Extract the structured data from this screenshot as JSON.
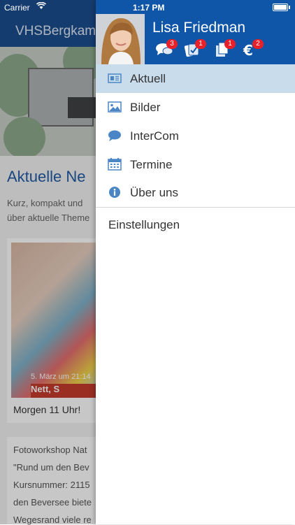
{
  "status_bar": {
    "carrier": "Carrier",
    "time": "1:17 PM"
  },
  "background": {
    "header_title": "VHSBergkam",
    "heading": "Aktuelle Ne",
    "intro_lines": [
      "Kurz, kompakt und",
      "über aktuelle Theme"
    ],
    "photo_date": "5. März um 21:14",
    "photo_sign": "Nett, S",
    "caption": "Morgen 11 Uhr!",
    "para_lines": [
      "Fotoworkshop Nat",
      "\"Rund um den Bev",
      "Kursnummer: 2115",
      "den Beversee biete",
      "Wegesrand viele re"
    ]
  },
  "drawer": {
    "user_name": "Lisa Friedman",
    "header_icons": [
      {
        "icon": "chat-icon",
        "badge": "3"
      },
      {
        "icon": "tickets-icon",
        "badge": "1"
      },
      {
        "icon": "documents-icon",
        "badge": "1"
      },
      {
        "icon": "euro-icon",
        "badge": "2"
      }
    ],
    "menu": [
      {
        "icon": "newspaper-icon",
        "label": "Aktuell",
        "active": true
      },
      {
        "icon": "image-icon",
        "label": "Bilder",
        "active": false
      },
      {
        "icon": "speech-bubble-icon",
        "label": "InterCom",
        "active": false
      },
      {
        "icon": "calendar-icon",
        "label": "Termine",
        "active": false
      },
      {
        "icon": "info-icon",
        "label": "Über uns",
        "active": false
      }
    ],
    "settings_label": "Einstellungen"
  },
  "colors": {
    "header_blue": "#0f56a8",
    "active_row": "#c9dcec",
    "icon_blue": "#4a86c5",
    "badge_red": "#e8202a"
  }
}
